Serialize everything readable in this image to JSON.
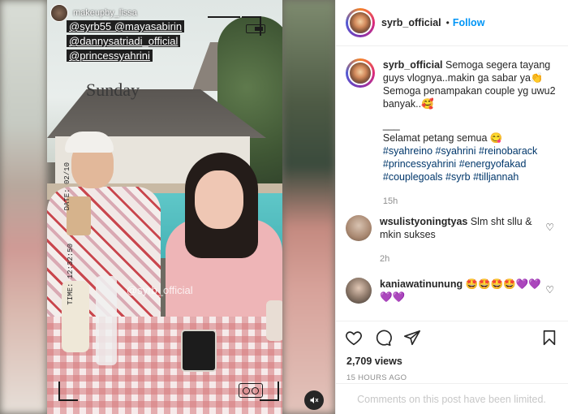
{
  "media": {
    "overlay_username": "makeupby_lissa",
    "tags": [
      "@syrb55 @mayasabirin",
      "@dannysatriadi_official",
      "@princessyahrini"
    ],
    "sunday_text": "Sunday",
    "watermark": "@syrb_official",
    "date_label": "DATE: 02/10",
    "time_label": "TIME: 12:32:50"
  },
  "header": {
    "username": "syrb_official",
    "separator": "•",
    "follow_label": "Follow"
  },
  "caption": {
    "username": "syrb_official",
    "text_line1": "Semoga segera tayang guys vlognya..makin ga sabar ya👏 Semoga penampakan couple yg uwu2 banyak..🥰",
    "divider": "___",
    "text_line2": "Selamat petang semua 😋",
    "hashtags": [
      "#syahreino",
      "#syahrini",
      "#reinobarack",
      "#princessyahrini",
      "#energyofakad",
      "#couplegoals",
      "#syrb",
      "#tilljannah"
    ],
    "time": "15h"
  },
  "comments": [
    {
      "username": "wsulistyoningtyas",
      "text": "Slm sht sllu & mkin sukses",
      "time": "2h"
    },
    {
      "username": "kaniawatinunung",
      "text": "🤩🤩🤩🤩💜💜💜💜",
      "time": ""
    }
  ],
  "actions": {
    "views": "2,709 views",
    "posted_ago": "15 HOURS AGO",
    "comments_limited": "Comments on this post have been limited."
  },
  "icons": [
    "heart-icon",
    "comment-icon",
    "share-icon",
    "bookmark-icon",
    "speaker-icon"
  ]
}
